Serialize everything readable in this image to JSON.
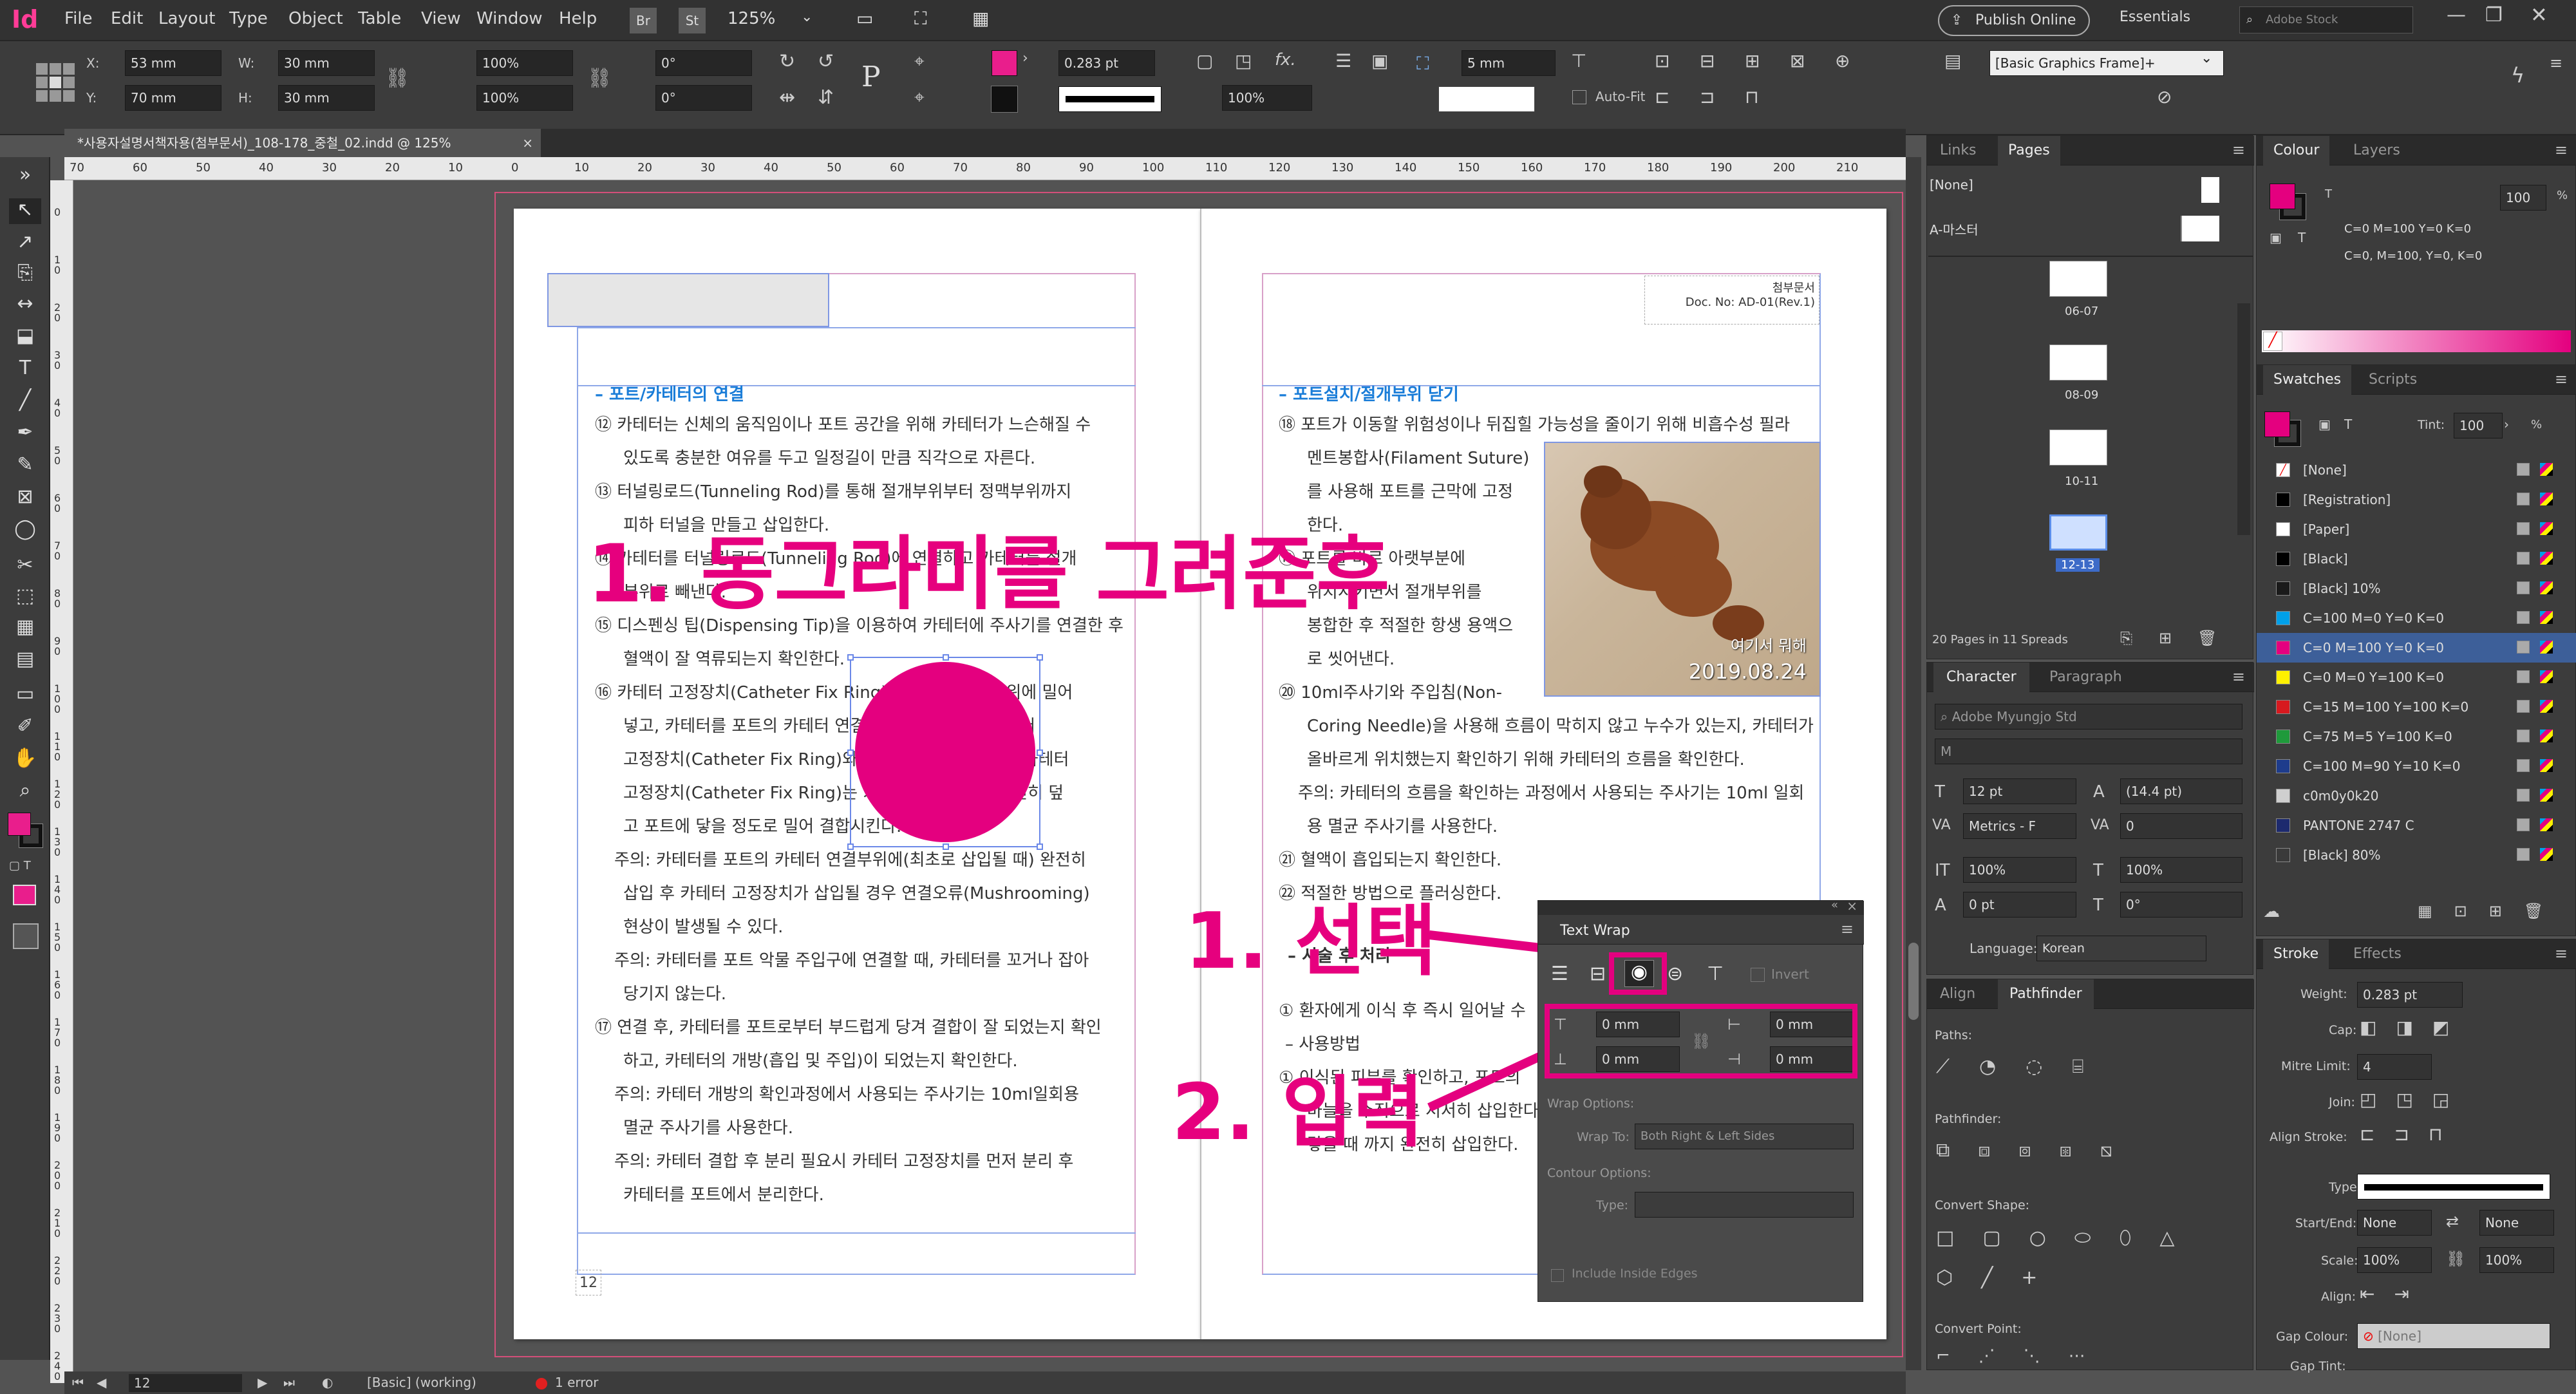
{
  "app": {
    "logo": "Id",
    "accent": "#e91e8c"
  },
  "menu": [
    "File",
    "Edit",
    "Layout",
    "Type",
    "Object",
    "Table",
    "View",
    "Window",
    "Help"
  ],
  "menubar": {
    "br": "Br",
    "st": "St",
    "zoom": "125%",
    "publish": "Publish Online",
    "workspace": "Essentials",
    "search_placeholder": "Adobe Stock"
  },
  "control": {
    "x": "53 mm",
    "y": "70 mm",
    "w": "30 mm",
    "h": "30 mm",
    "scale_x": "100%",
    "scale_y": "100%",
    "rot": "0°",
    "shear": "0°",
    "stroke_weight": "0.283 pt",
    "opacity": "100%",
    "gap": "5 mm",
    "autofit": "Auto-Fit",
    "style": "[Basic Graphics Frame]+",
    "labels": {
      "x": "X:",
      "y": "Y:",
      "w": "W:",
      "h": "H:"
    }
  },
  "document": {
    "tab_title": "*사용자설명서책자용(첨부문서)_108-178_중철_02.indd @ 125%",
    "ruler_h": [
      "70",
      "60",
      "50",
      "40",
      "30",
      "20",
      "10",
      "0",
      "10",
      "20",
      "30",
      "40",
      "50",
      "60",
      "70",
      "80",
      "90",
      "100",
      "110",
      "120",
      "130",
      "140",
      "150",
      "160",
      "170",
      "180",
      "190",
      "200",
      "210"
    ],
    "ruler_v": [
      "0",
      "1 0",
      "2 0",
      "3 0",
      "4 0",
      "5 0",
      "6 0",
      "7 0",
      "8 0",
      "9 0",
      "1 0 0",
      "1 1 0",
      "1 2 0",
      "1 3 0",
      "1 4 0",
      "1 5 0",
      "1 6 0",
      "1 7 0",
      "1 8 0",
      "1 9 0",
      "2 0 0",
      "2 1 0",
      "2 2 0",
      "2 3 0",
      "2 4 0"
    ],
    "left_page": {
      "heading": "– 포트/카테터의 연결",
      "lines": [
        "⑫ 카테터는 신체의 움직임이나 포트 공간을 위해 카테터가 느슨해질 수",
        "있도록 충분한 여유를 두고 일정길이 만큼 직각으로 자른다.",
        "⑬ 터널링로드(Tunneling Rod)를 통해 절개부위부터 정맥부위까지",
        "피하 터널을 만들고 삽입한다.",
        "⑭ 카테터를 터널링로드(Tunneling Rod)에 연결하고 카테터를 절개",
        "부위로 빼낸다.",
        "⑮ 디스펜싱 팁(Dispensing Tip)을 이용하여 카테터에 주사기를 연결한 후",
        "혈액이 잘 역류되는지 확인한다.",
        "⑯ 카테터 고정장치(Catheter Fix Ring)를 카테터 연결부위에 밀어",
        "넣고, 카테터를 포트의 카테터 연결부위에 삽입한 후 카테터",
        "고정장치(Catheter Fix Ring)와 포트를 연결한다. 이때 카테터",
        "고정장치(Catheter Fix Ring)는 카테터 연결부위를 완전히 덮",
        "고 포트에 닿을 정도로 밀어 결합시킨다.",
        "주의: 카테터를 포트의 카테터 연결부위에(최초로 삽입될 때) 완전히",
        "삽입 후 카테터 고정장치가 삽입될 경우 연결오류(Mushrooming)",
        "현상이 발생될 수 있다.",
        "주의: 카테터를 포트 악물 주입구에 연결할 때, 카테터를 꼬거나 잡아",
        "당기지 않는다.",
        "⑰ 연결 후, 카테터를 포트로부터 부드럽게 당겨 결합이 잘 되었는지 확인",
        "하고, 카테터의 개방(흡입 및 주입)이 되었는지 확인한다.",
        "주의: 카테터 개방의 확인과정에서 사용되는 주사기는 10ml일회용",
        "멸균 주사기를 사용한다.",
        "주의: 카테터 결합 후 분리 필요시 카테터 고정장치를 먼저 분리 후",
        "카테터를 포트에서 분리한다."
      ],
      "page_number": "12"
    },
    "right_page": {
      "header_line1": "첨부문서",
      "header_line2": "Doc. No: AD-01(Rev.1)",
      "heading": "– 포트설치/절개부위 닫기",
      "lines": [
        "⑱ 포트가 이동할 위험성이나 뒤집힐 가능성을 줄이기 위해 비흡수성 필라",
        "멘트봉합사(Filament Suture)",
        "를 사용해 포트를 근막에 고정",
        "한다.",
        "⑲ 포트를 바로 아랫부분에",
        "위치시키면서 절개부위를",
        "봉합한 후 적절한 항생 용액으",
        "로 씻어낸다.",
        "⑳ 10ml주사기와 주입침(Non-",
        "Coring Needle)을 사용해 흐름이 막히지 않고 누수가 있는지, 카테터가",
        "올바르게 위치했는지 확인하기 위해 카테터의 흐름을 확인한다.",
        "주의: 카테터의 흐름을 확인하는 과정에서 사용되는 주사기는 10ml 일회",
        "용 멸균 주사기를 사용한다.",
        "㉑ 혈액이 흡입되는지 확인한다.",
        "㉒ 적절한 방법으로 플러싱한다."
      ],
      "sub_heading": "– 시술 후 처리",
      "lines2": [
        "① 환자에게 이식 후 즉시 일어날 수",
        "",
        "– 사용방법",
        "① 이식된 피부를 확인하고, 포트의",
        "바늘을 수직으로 서서히 삽입한다",
        "닿을 때 까지 완전히 삽입한다."
      ],
      "photo_caption": "여기서 뭐해",
      "photo_date": "2019.08.24"
    }
  },
  "annotations": {
    "big": "1. 동그라미를 그려준후",
    "select": "1. 선택",
    "input": "2. 입력"
  },
  "text_wrap": {
    "title": "Text Wrap",
    "invert": "Invert",
    "top": "0 mm",
    "bottom": "0 mm",
    "left": "0 mm",
    "right": "0 mm",
    "wrap_options": "Wrap Options:",
    "wrap_to_label": "Wrap To:",
    "wrap_to": "Both Right & Left Sides",
    "contour_options": "Contour Options:",
    "type_label": "Type:",
    "include_edges": "Include Inside Edges"
  },
  "pages_panel": {
    "tabs": [
      "Links",
      "Pages"
    ],
    "none": "[None]",
    "master": "A-마스터",
    "spreads": [
      "06-07",
      "08-09",
      "10-11",
      "12-13"
    ],
    "summary": "20 Pages in 11 Spreads"
  },
  "character_panel": {
    "tabs": [
      "Character",
      "Paragraph"
    ],
    "font": "Adobe Myungjo Std",
    "style": "M",
    "size": "12 pt",
    "leading": "(14.4 pt)",
    "kerning": "Metrics - F",
    "tracking": "0",
    "vscale": "100%",
    "hscale": "100%",
    "baseline": "0 pt",
    "skew": "0°",
    "language_label": "Language:",
    "language": "Korean"
  },
  "pathfinder_panel": {
    "tabs": [
      "Align",
      "Pathfinder"
    ],
    "paths": "Paths:",
    "pathfinder": "Pathfinder:",
    "convert_shape": "Convert Shape:",
    "convert_point": "Convert Point:"
  },
  "colour_panel": {
    "tabs": [
      "Colour",
      "Layers"
    ],
    "tint": "100",
    "cmyk1": "C=0 M=100 Y=0 K=0",
    "cmyk2": "C=0, M=100, Y=0, K=0"
  },
  "swatches_panel": {
    "tabs": [
      "Swatches",
      "Scripts"
    ],
    "tint_label": "Tint:",
    "tint": "100",
    "items": [
      {
        "name": "[None]",
        "color": "#ffffff"
      },
      {
        "name": "[Registration]",
        "color": "#000000"
      },
      {
        "name": "[Paper]",
        "color": "#ffffff"
      },
      {
        "name": "[Black]",
        "color": "#000000"
      },
      {
        "name": "[Black] 10%",
        "color": "#1a1a1a"
      },
      {
        "name": "C=100 M=0 Y=0 K=0",
        "color": "#00a0e9"
      },
      {
        "name": "C=0 M=100 Y=0 K=0",
        "color": "#e4007f"
      },
      {
        "name": "C=0 M=0 Y=100 K=0",
        "color": "#fff100"
      },
      {
        "name": "C=15 M=100 Y=100 K=0",
        "color": "#d7191f"
      },
      {
        "name": "C=75 M=5 Y=100 K=0",
        "color": "#1f9a3b"
      },
      {
        "name": "C=100 M=90 Y=10 K=0",
        "color": "#1e3c8c"
      },
      {
        "name": "c0m0y0k20",
        "color": "#cfcfcf"
      },
      {
        "name": "PANTONE 2747 C",
        "color": "#1d2a6e"
      },
      {
        "name": "[Black] 80%",
        "color": "#3a3a3a"
      }
    ]
  },
  "stroke_panel": {
    "tabs": [
      "Stroke",
      "Effects"
    ],
    "weight_label": "Weight:",
    "weight": "0.283 pt",
    "cap_label": "Cap:",
    "mitre_label": "Mitre Limit:",
    "mitre": "4",
    "join_label": "Join:",
    "align_label": "Align Stroke:",
    "type_label": "Type:",
    "start_label": "Start/End:",
    "start": "None",
    "end": "None",
    "scale_label": "Scale:",
    "scale1": "100%",
    "scale2": "100%",
    "align2_label": "Align:",
    "gap_colour_label": "Gap Colour:",
    "gap_colour": "[None]",
    "gap_tint_label": "Gap Tint:"
  },
  "statusbar": {
    "page": "12",
    "style": "[Basic] (working)",
    "errors": "1 error"
  }
}
